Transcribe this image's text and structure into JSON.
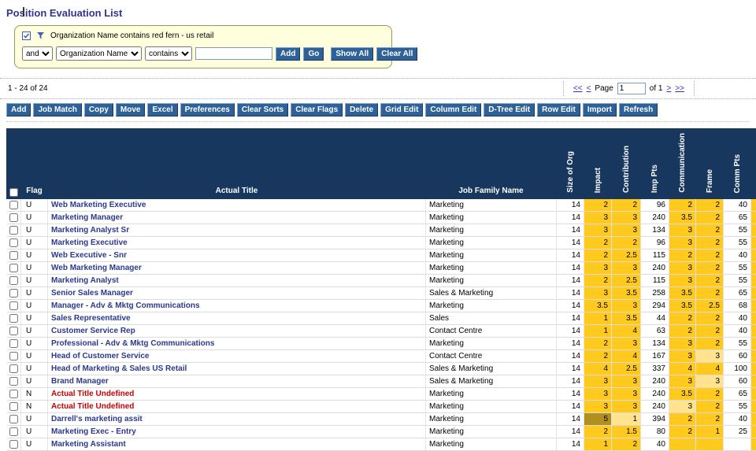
{
  "page": {
    "title": "Position Evaluation List"
  },
  "icons": {
    "filter_checkbox_icon": "checkbox",
    "filter_funnel_icon": "funnel"
  },
  "filter": {
    "summary": "Organization Name contains red fern - us retail",
    "bool_operator": "and",
    "field": "Organization Name",
    "operator": "contains",
    "input_value": "",
    "buttons": {
      "add": "Add",
      "go": "Go",
      "show_all": "Show All",
      "clear_all": "Clear All"
    }
  },
  "pagination": {
    "range_text": "1 - 24 of 24",
    "first": "<<",
    "prev": "<",
    "page_label": "Page",
    "current_page": "1",
    "of_text": "of 1",
    "next": ">",
    "last": ">>"
  },
  "toolbar": {
    "buttons": [
      "Add",
      "Job Match",
      "Copy",
      "Move",
      "Excel",
      "Preferences",
      "Clear Sorts",
      "Clear Flags",
      "Delete",
      "Grid Edit",
      "Column Edit",
      "D-Tree Edit",
      "Row Edit",
      "Import",
      "Refresh"
    ]
  },
  "table": {
    "horizontal_headers": [
      "Flag",
      "Actual Title",
      "Job Family Name"
    ],
    "vertical_headers": [
      "Size of Org",
      "Impact",
      "Contribution",
      "Imp Pts",
      "Communication",
      "Frame",
      "Comm Pts"
    ],
    "rows": [
      {
        "flag": "U",
        "title": "Web Marketing Executive",
        "family": "Marketing",
        "size_of_org": "14",
        "impact": "2",
        "contribution": "2",
        "imp_pts": "96",
        "communication": "2",
        "frame": "2",
        "comm_pts": "40"
      },
      {
        "flag": "U",
        "title": "Marketing Manager",
        "family": "Marketing",
        "size_of_org": "14",
        "impact": "3",
        "contribution": "3",
        "imp_pts": "240",
        "communication": "3.5",
        "frame": "2",
        "comm_pts": "65"
      },
      {
        "flag": "U",
        "title": "Marketing Analyst Sr",
        "family": "Marketing",
        "size_of_org": "14",
        "impact": "3",
        "contribution": "3",
        "imp_pts": "134",
        "communication": "3",
        "frame": "2",
        "comm_pts": "55"
      },
      {
        "flag": "U",
        "title": "Marketing Executive",
        "family": "Marketing",
        "size_of_org": "14",
        "impact": "2",
        "contribution": "2",
        "imp_pts": "96",
        "communication": "3",
        "frame": "2",
        "comm_pts": "55"
      },
      {
        "flag": "U",
        "title": "Web Executive - Snr",
        "family": "Marketing",
        "size_of_org": "14",
        "impact": "2",
        "contribution": "2.5",
        "imp_pts": "115",
        "communication": "2",
        "frame": "2",
        "comm_pts": "40"
      },
      {
        "flag": "U",
        "title": "Web Marketing Manager",
        "family": "Marketing",
        "size_of_org": "14",
        "impact": "3",
        "contribution": "3",
        "imp_pts": "240",
        "communication": "3",
        "frame": "2",
        "comm_pts": "55"
      },
      {
        "flag": "U",
        "title": "Marketing Analyst",
        "family": "Marketing",
        "size_of_org": "14",
        "impact": "2",
        "contribution": "2.5",
        "imp_pts": "115",
        "communication": "3",
        "frame": "2",
        "comm_pts": "55"
      },
      {
        "flag": "U",
        "title": "Senior Sales Manager",
        "family": "Sales & Marketing",
        "size_of_org": "14",
        "impact": "3",
        "contribution": "3.5",
        "imp_pts": "258",
        "communication": "3.5",
        "frame": "2",
        "comm_pts": "65"
      },
      {
        "flag": "U",
        "title": "Manager - Adv & Mktg Communications",
        "family": "Marketing",
        "size_of_org": "14",
        "impact": "3.5",
        "contribution": "3",
        "imp_pts": "294",
        "communication": "3.5",
        "frame": "2.5",
        "comm_pts": "68"
      },
      {
        "flag": "U",
        "title": "Sales Representative",
        "family": "Sales",
        "size_of_org": "14",
        "impact": "1",
        "contribution": "3.5",
        "imp_pts": "44",
        "communication": "2",
        "frame": "2",
        "comm_pts": "40"
      },
      {
        "flag": "U",
        "title": "Customer Service Rep",
        "family": "Contact Centre",
        "size_of_org": "14",
        "impact": "1",
        "contribution": "4",
        "imp_pts": "63",
        "communication": "2",
        "frame": "2",
        "comm_pts": "40"
      },
      {
        "flag": "U",
        "title": "Professional - Adv & Mktg Communications",
        "family": "Marketing",
        "size_of_org": "14",
        "impact": "2",
        "contribution": "3",
        "imp_pts": "134",
        "communication": "3",
        "frame": "2",
        "comm_pts": "55"
      },
      {
        "flag": "U",
        "title": "Head of Customer Service",
        "family": "Contact Centre",
        "size_of_org": "14",
        "impact": "2",
        "contribution": "4",
        "imp_pts": "167",
        "communication": "3",
        "frame": "3",
        "comm_pts": "60",
        "shades": {
          "frame": "light"
        }
      },
      {
        "flag": "U",
        "title": "Head of Marketing & Sales US Retail",
        "family": "Sales & Marketing",
        "size_of_org": "14",
        "impact": "4",
        "contribution": "2.5",
        "imp_pts": "337",
        "communication": "4",
        "frame": "4",
        "comm_pts": "100"
      },
      {
        "flag": "U",
        "title": "Brand Manager",
        "family": "Sales & Marketing",
        "size_of_org": "14",
        "impact": "3",
        "contribution": "3",
        "imp_pts": "240",
        "communication": "3",
        "frame": "3",
        "comm_pts": "60",
        "shades": {
          "frame": "light"
        }
      },
      {
        "flag": "N",
        "title": "Actual Title Undefined",
        "family": "Marketing",
        "size_of_org": "14",
        "impact": "3",
        "contribution": "3",
        "imp_pts": "240",
        "communication": "3.5",
        "frame": "2",
        "comm_pts": "65",
        "title_style": "red"
      },
      {
        "flag": "N",
        "title": "Actual Title Undefined",
        "family": "Marketing",
        "size_of_org": "14",
        "impact": "3",
        "contribution": "3",
        "imp_pts": "240",
        "communication": "3",
        "frame": "2",
        "comm_pts": "55",
        "title_style": "red",
        "shades": {
          "communication": "light"
        }
      },
      {
        "flag": "U",
        "title": "Darrell's marketing assit",
        "family": "Marketing",
        "size_of_org": "14",
        "impact": "5",
        "contribution": "1",
        "imp_pts": "394",
        "communication": "2",
        "frame": "2",
        "comm_pts": "40",
        "shades": {
          "impact": "dark",
          "contribution": "light"
        }
      },
      {
        "flag": "U",
        "title": "Marketing Exec - Entry",
        "family": "Marketing",
        "size_of_org": "14",
        "impact": "2",
        "contribution": "1.5",
        "imp_pts": "80",
        "communication": "2",
        "frame": "1",
        "comm_pts": "25"
      },
      {
        "flag": "U",
        "title": "Marketing Assistant",
        "family": "Marketing",
        "size_of_org": "14",
        "impact": "1",
        "contribution": "2",
        "imp_pts": "40",
        "communication": "",
        "frame": "",
        "comm_pts": ""
      }
    ]
  },
  "colors": {
    "header_navy": "#17375E",
    "button_blue": "#2D6197",
    "title_blue": "#333399",
    "row_title_blue": "#2B3990",
    "link_blue": "#3333CC",
    "gold": "#FFC91E",
    "gold_light": "#FFE38F",
    "gold_dark": "#B08F1F",
    "red": "#CC0000",
    "filter_bg": "#FFFFDE",
    "filter_border": "#99995C"
  }
}
